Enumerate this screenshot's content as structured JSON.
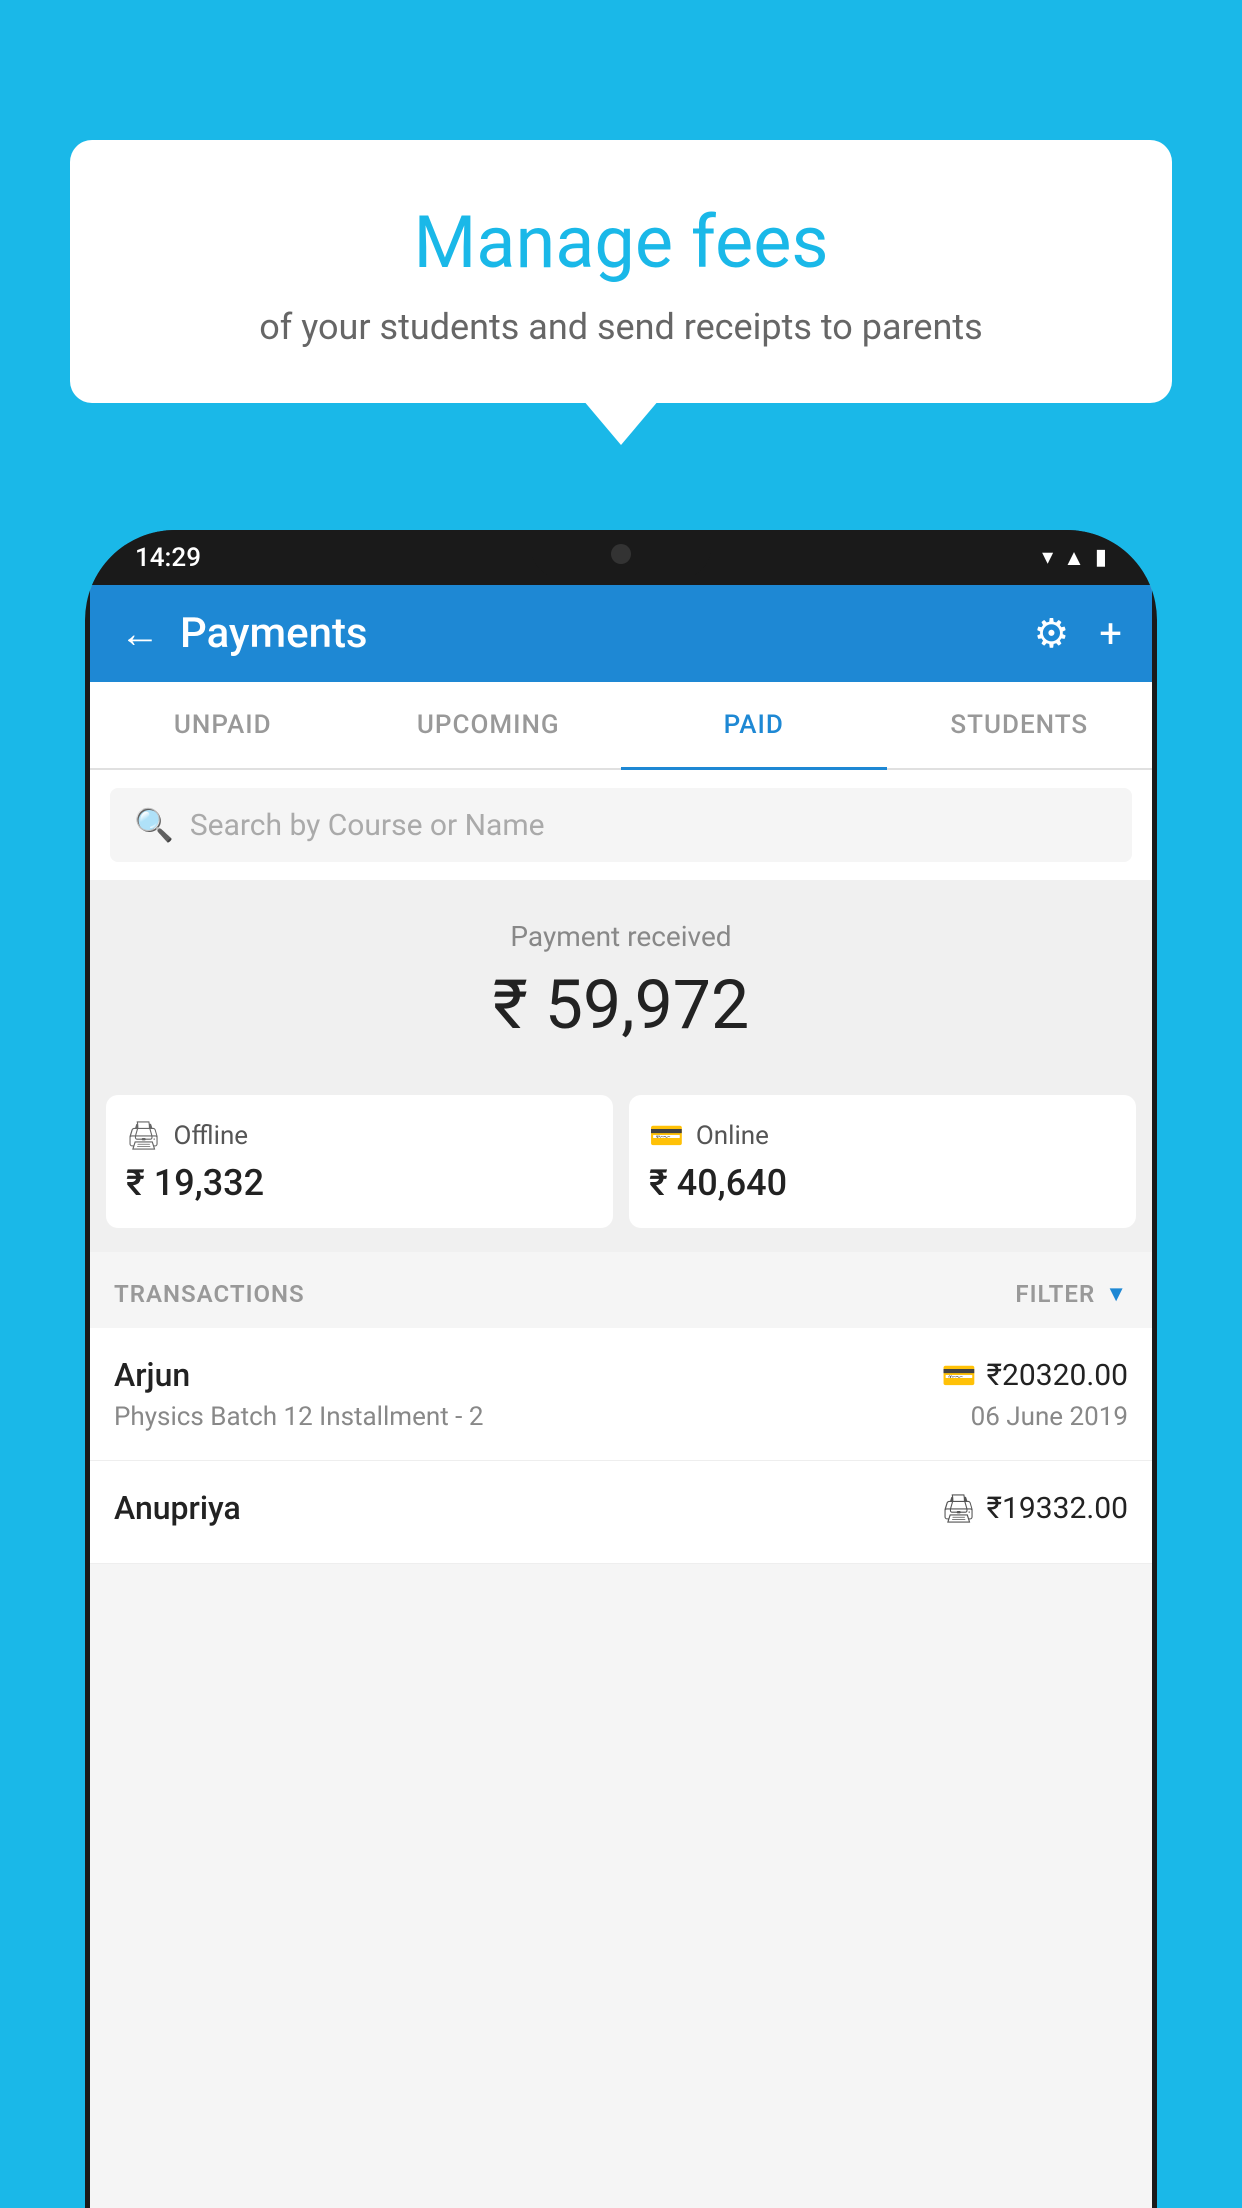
{
  "background_color": "#1ab8e8",
  "speech_bubble": {
    "title": "Manage fees",
    "subtitle": "of your students and send receipts to parents"
  },
  "phone": {
    "time": "14:29",
    "header": {
      "title": "Payments",
      "back_label": "←",
      "settings_label": "⚙",
      "add_label": "+"
    },
    "tabs": [
      {
        "label": "UNPAID",
        "active": false
      },
      {
        "label": "UPCOMING",
        "active": false
      },
      {
        "label": "PAID",
        "active": true
      },
      {
        "label": "STUDENTS",
        "active": false
      }
    ],
    "search": {
      "placeholder": "Search by Course or Name"
    },
    "payment_summary": {
      "label": "Payment received",
      "amount": "₹ 59,972",
      "offline": {
        "label": "Offline",
        "amount": "₹ 19,332"
      },
      "online": {
        "label": "Online",
        "amount": "₹ 40,640"
      }
    },
    "transactions": {
      "label": "TRANSACTIONS",
      "filter_label": "FILTER",
      "items": [
        {
          "name": "Arjun",
          "amount": "₹20320.00",
          "course": "Physics Batch 12 Installment - 2",
          "date": "06 June 2019",
          "payment_type": "online"
        },
        {
          "name": "Anupriya",
          "amount": "₹19332.00",
          "course": "",
          "date": "",
          "payment_type": "offline"
        }
      ]
    }
  }
}
